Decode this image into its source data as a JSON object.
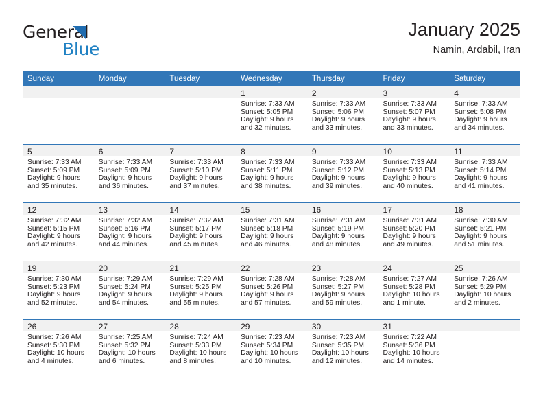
{
  "brand": {
    "name_top": "General",
    "name_bottom": "Blue",
    "triangle_color": "#1f6cb0",
    "blue_color": "#2081c3"
  },
  "header": {
    "title": "January 2025",
    "subtitle": "Namin, Ardabil, Iran"
  },
  "theme": {
    "header_row_bg": "#3277b8",
    "daynum_band_bg": "#f1f1f1",
    "grid_line": "#3277b8",
    "text": "#231f20"
  },
  "weekdays": [
    "Sunday",
    "Monday",
    "Tuesday",
    "Wednesday",
    "Thursday",
    "Friday",
    "Saturday"
  ],
  "weeks": [
    [
      {
        "empty": true
      },
      {
        "empty": true
      },
      {
        "empty": true
      },
      {
        "day": "1",
        "sunrise": "Sunrise: 7:33 AM",
        "sunset": "Sunset: 5:05 PM",
        "daylight1": "Daylight: 9 hours",
        "daylight2": "and 32 minutes."
      },
      {
        "day": "2",
        "sunrise": "Sunrise: 7:33 AM",
        "sunset": "Sunset: 5:06 PM",
        "daylight1": "Daylight: 9 hours",
        "daylight2": "and 33 minutes."
      },
      {
        "day": "3",
        "sunrise": "Sunrise: 7:33 AM",
        "sunset": "Sunset: 5:07 PM",
        "daylight1": "Daylight: 9 hours",
        "daylight2": "and 33 minutes."
      },
      {
        "day": "4",
        "sunrise": "Sunrise: 7:33 AM",
        "sunset": "Sunset: 5:08 PM",
        "daylight1": "Daylight: 9 hours",
        "daylight2": "and 34 minutes."
      }
    ],
    [
      {
        "day": "5",
        "sunrise": "Sunrise: 7:33 AM",
        "sunset": "Sunset: 5:09 PM",
        "daylight1": "Daylight: 9 hours",
        "daylight2": "and 35 minutes."
      },
      {
        "day": "6",
        "sunrise": "Sunrise: 7:33 AM",
        "sunset": "Sunset: 5:09 PM",
        "daylight1": "Daylight: 9 hours",
        "daylight2": "and 36 minutes."
      },
      {
        "day": "7",
        "sunrise": "Sunrise: 7:33 AM",
        "sunset": "Sunset: 5:10 PM",
        "daylight1": "Daylight: 9 hours",
        "daylight2": "and 37 minutes."
      },
      {
        "day": "8",
        "sunrise": "Sunrise: 7:33 AM",
        "sunset": "Sunset: 5:11 PM",
        "daylight1": "Daylight: 9 hours",
        "daylight2": "and 38 minutes."
      },
      {
        "day": "9",
        "sunrise": "Sunrise: 7:33 AM",
        "sunset": "Sunset: 5:12 PM",
        "daylight1": "Daylight: 9 hours",
        "daylight2": "and 39 minutes."
      },
      {
        "day": "10",
        "sunrise": "Sunrise: 7:33 AM",
        "sunset": "Sunset: 5:13 PM",
        "daylight1": "Daylight: 9 hours",
        "daylight2": "and 40 minutes."
      },
      {
        "day": "11",
        "sunrise": "Sunrise: 7:33 AM",
        "sunset": "Sunset: 5:14 PM",
        "daylight1": "Daylight: 9 hours",
        "daylight2": "and 41 minutes."
      }
    ],
    [
      {
        "day": "12",
        "sunrise": "Sunrise: 7:32 AM",
        "sunset": "Sunset: 5:15 PM",
        "daylight1": "Daylight: 9 hours",
        "daylight2": "and 42 minutes."
      },
      {
        "day": "13",
        "sunrise": "Sunrise: 7:32 AM",
        "sunset": "Sunset: 5:16 PM",
        "daylight1": "Daylight: 9 hours",
        "daylight2": "and 44 minutes."
      },
      {
        "day": "14",
        "sunrise": "Sunrise: 7:32 AM",
        "sunset": "Sunset: 5:17 PM",
        "daylight1": "Daylight: 9 hours",
        "daylight2": "and 45 minutes."
      },
      {
        "day": "15",
        "sunrise": "Sunrise: 7:31 AM",
        "sunset": "Sunset: 5:18 PM",
        "daylight1": "Daylight: 9 hours",
        "daylight2": "and 46 minutes."
      },
      {
        "day": "16",
        "sunrise": "Sunrise: 7:31 AM",
        "sunset": "Sunset: 5:19 PM",
        "daylight1": "Daylight: 9 hours",
        "daylight2": "and 48 minutes."
      },
      {
        "day": "17",
        "sunrise": "Sunrise: 7:31 AM",
        "sunset": "Sunset: 5:20 PM",
        "daylight1": "Daylight: 9 hours",
        "daylight2": "and 49 minutes."
      },
      {
        "day": "18",
        "sunrise": "Sunrise: 7:30 AM",
        "sunset": "Sunset: 5:21 PM",
        "daylight1": "Daylight: 9 hours",
        "daylight2": "and 51 minutes."
      }
    ],
    [
      {
        "day": "19",
        "sunrise": "Sunrise: 7:30 AM",
        "sunset": "Sunset: 5:23 PM",
        "daylight1": "Daylight: 9 hours",
        "daylight2": "and 52 minutes."
      },
      {
        "day": "20",
        "sunrise": "Sunrise: 7:29 AM",
        "sunset": "Sunset: 5:24 PM",
        "daylight1": "Daylight: 9 hours",
        "daylight2": "and 54 minutes."
      },
      {
        "day": "21",
        "sunrise": "Sunrise: 7:29 AM",
        "sunset": "Sunset: 5:25 PM",
        "daylight1": "Daylight: 9 hours",
        "daylight2": "and 55 minutes."
      },
      {
        "day": "22",
        "sunrise": "Sunrise: 7:28 AM",
        "sunset": "Sunset: 5:26 PM",
        "daylight1": "Daylight: 9 hours",
        "daylight2": "and 57 minutes."
      },
      {
        "day": "23",
        "sunrise": "Sunrise: 7:28 AM",
        "sunset": "Sunset: 5:27 PM",
        "daylight1": "Daylight: 9 hours",
        "daylight2": "and 59 minutes."
      },
      {
        "day": "24",
        "sunrise": "Sunrise: 7:27 AM",
        "sunset": "Sunset: 5:28 PM",
        "daylight1": "Daylight: 10 hours",
        "daylight2": "and 1 minute."
      },
      {
        "day": "25",
        "sunrise": "Sunrise: 7:26 AM",
        "sunset": "Sunset: 5:29 PM",
        "daylight1": "Daylight: 10 hours",
        "daylight2": "and 2 minutes."
      }
    ],
    [
      {
        "day": "26",
        "sunrise": "Sunrise: 7:26 AM",
        "sunset": "Sunset: 5:30 PM",
        "daylight1": "Daylight: 10 hours",
        "daylight2": "and 4 minutes."
      },
      {
        "day": "27",
        "sunrise": "Sunrise: 7:25 AM",
        "sunset": "Sunset: 5:32 PM",
        "daylight1": "Daylight: 10 hours",
        "daylight2": "and 6 minutes."
      },
      {
        "day": "28",
        "sunrise": "Sunrise: 7:24 AM",
        "sunset": "Sunset: 5:33 PM",
        "daylight1": "Daylight: 10 hours",
        "daylight2": "and 8 minutes."
      },
      {
        "day": "29",
        "sunrise": "Sunrise: 7:23 AM",
        "sunset": "Sunset: 5:34 PM",
        "daylight1": "Daylight: 10 hours",
        "daylight2": "and 10 minutes."
      },
      {
        "day": "30",
        "sunrise": "Sunrise: 7:23 AM",
        "sunset": "Sunset: 5:35 PM",
        "daylight1": "Daylight: 10 hours",
        "daylight2": "and 12 minutes."
      },
      {
        "day": "31",
        "sunrise": "Sunrise: 7:22 AM",
        "sunset": "Sunset: 5:36 PM",
        "daylight1": "Daylight: 10 hours",
        "daylight2": "and 14 minutes."
      },
      {
        "empty": true
      }
    ]
  ]
}
